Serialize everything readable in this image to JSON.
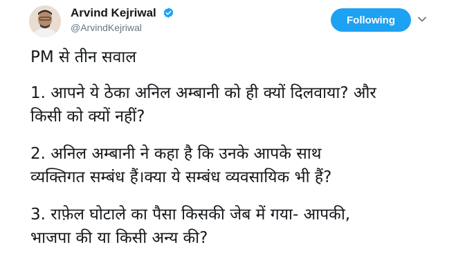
{
  "account": {
    "display_name": "Arvind Kejriwal",
    "handle": "@ArvindKejriwal",
    "verified": true
  },
  "follow_button": {
    "label": "Following"
  },
  "menu_icon": "chevron-down-icon",
  "tweet": {
    "lines": [
      "PM से तीन सवाल",
      "1. आपने ये ठेका अनिल अम्बानी को ही क्यों दिलवाया? और\nकिसी को क्यों नहीं?",
      "2. अनिल अम्बानी ने कहा है कि उनके आपके साथ\nव्यक्तिगत सम्बंध हैं।क्या ये सम्बंध व्यवसायिक भी हैं?",
      "3. राफ़ेल घोटाले का पैसा किसकी जेब में गया- आपकी,\nभाजपा की या किसी अन्य की?"
    ]
  },
  "colors": {
    "accent": "#1da1f2",
    "text": "#14171a",
    "muted": "#657786"
  }
}
